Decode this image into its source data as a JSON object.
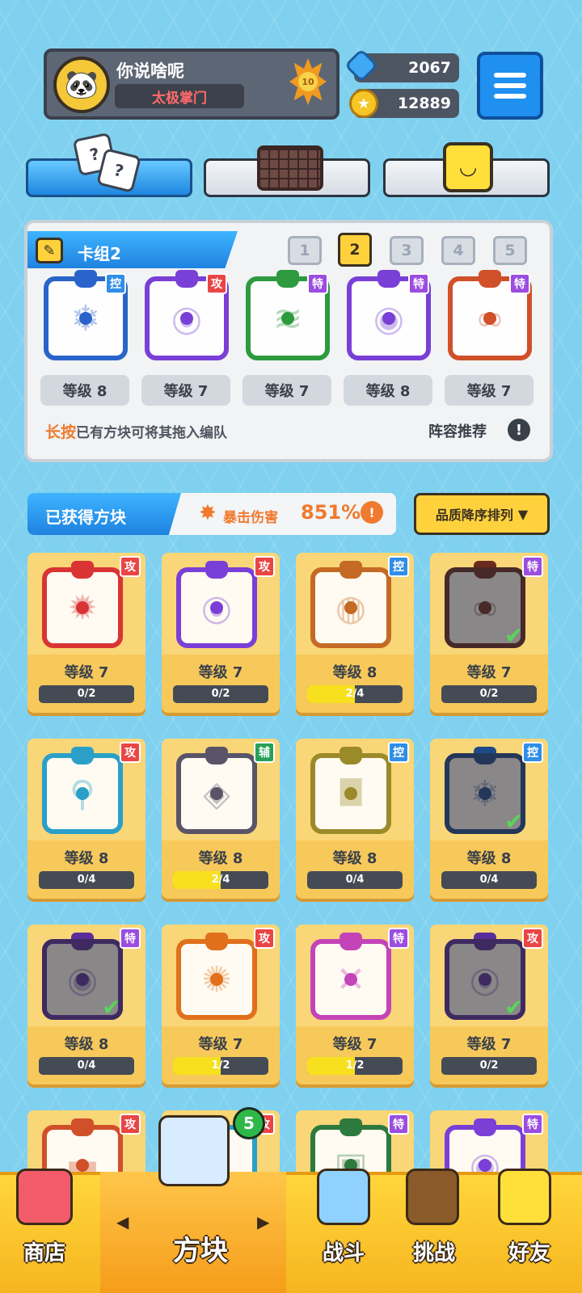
{
  "header": {
    "player_name": "你说啥呢",
    "player_title": "太极掌门",
    "level": "10",
    "gems": "2067",
    "coins": "12889"
  },
  "deck": {
    "name": "卡组2",
    "slots": [
      "1",
      "2",
      "3",
      "4",
      "5"
    ],
    "active_slot": 1,
    "cards": [
      {
        "tag": "控",
        "level": "等级 8",
        "color": "#2a63c9",
        "glyph": "❄"
      },
      {
        "tag": "攻",
        "level": "等级 7",
        "color": "#7a3fd6",
        "glyph": "◎"
      },
      {
        "tag": "特",
        "level": "等级 7",
        "color": "#2e9a3e",
        "glyph": "≋"
      },
      {
        "tag": "特",
        "level": "等级 8",
        "color": "#7a3fd6",
        "glyph": "◉"
      },
      {
        "tag": "特",
        "level": "等级 7",
        "color": "#d0502a",
        "glyph": "∞"
      }
    ],
    "hint_highlight": "长按",
    "hint_text": "已有方块可将其拖入编队",
    "recommend_label": "阵容推荐"
  },
  "owned": {
    "title": "已获得方块",
    "crit_label": "暴击伤害",
    "crit_value": "851%",
    "sort_label": "品质降序排列",
    "cards": [
      {
        "tag": "攻",
        "level": "等级 7",
        "progress": "0/2",
        "fill": 0,
        "color": "#d83434",
        "glyph": "✹",
        "equipped": false
      },
      {
        "tag": "攻",
        "level": "等级 7",
        "progress": "0/2",
        "fill": 0,
        "color": "#7a3fd6",
        "glyph": "◎",
        "equipped": false
      },
      {
        "tag": "控",
        "level": "等级 8",
        "progress": "2/4",
        "fill": 0.5,
        "color": "#c46a24",
        "glyph": "◍",
        "equipped": false
      },
      {
        "tag": "特",
        "level": "等级 7",
        "progress": "0/2",
        "fill": 0,
        "color": "#6b2a1e",
        "glyph": "∞",
        "equipped": true
      },
      {
        "tag": "攻",
        "level": "等级 8",
        "progress": "0/4",
        "fill": 0,
        "color": "#2aa0c9",
        "glyph": "⚲",
        "equipped": false
      },
      {
        "tag": "辅",
        "level": "等级 8",
        "progress": "2/4",
        "fill": 0.5,
        "color": "#5a5468",
        "glyph": "◈",
        "equipped": false
      },
      {
        "tag": "控",
        "level": "等级 8",
        "progress": "0/4",
        "fill": 0,
        "color": "#9a8a2a",
        "glyph": "◘",
        "equipped": false
      },
      {
        "tag": "控",
        "level": "等级 8",
        "progress": "0/4",
        "fill": 0,
        "color": "#1f4a8a",
        "glyph": "❄",
        "equipped": true
      },
      {
        "tag": "特",
        "level": "等级 8",
        "progress": "0/4",
        "fill": 0,
        "color": "#5a2e9a",
        "glyph": "◉",
        "equipped": true
      },
      {
        "tag": "攻",
        "level": "等级 7",
        "progress": "1/2",
        "fill": 0.5,
        "color": "#e0701c",
        "glyph": "✺",
        "equipped": false
      },
      {
        "tag": "特",
        "level": "等级 7",
        "progress": "1/2",
        "fill": 0.5,
        "color": "#c444b8",
        "glyph": "✕",
        "equipped": false
      },
      {
        "tag": "攻",
        "level": "等级 7",
        "progress": "0/2",
        "fill": 0,
        "color": "#5a2e9a",
        "glyph": "◎",
        "equipped": true
      },
      {
        "tag": "攻",
        "level": "",
        "progress": "",
        "fill": 0,
        "color": "#d0502a",
        "glyph": "▬",
        "equipped": false
      },
      {
        "tag": "攻",
        "level": "",
        "progress": "",
        "fill": 0,
        "color": "#2aa0c9",
        "glyph": "◇",
        "equipped": false
      },
      {
        "tag": "特",
        "level": "",
        "progress": "",
        "fill": 0,
        "color": "#2e7a3e",
        "glyph": "▣",
        "equipped": false
      },
      {
        "tag": "特",
        "level": "",
        "progress": "",
        "fill": 0,
        "color": "#7a3fd6",
        "glyph": "◉",
        "equipped": false
      }
    ]
  },
  "nav": {
    "shop": "商店",
    "blocks": "方块",
    "battle": "战斗",
    "challenge": "挑战",
    "friends": "好友",
    "blocks_badge": "5"
  }
}
